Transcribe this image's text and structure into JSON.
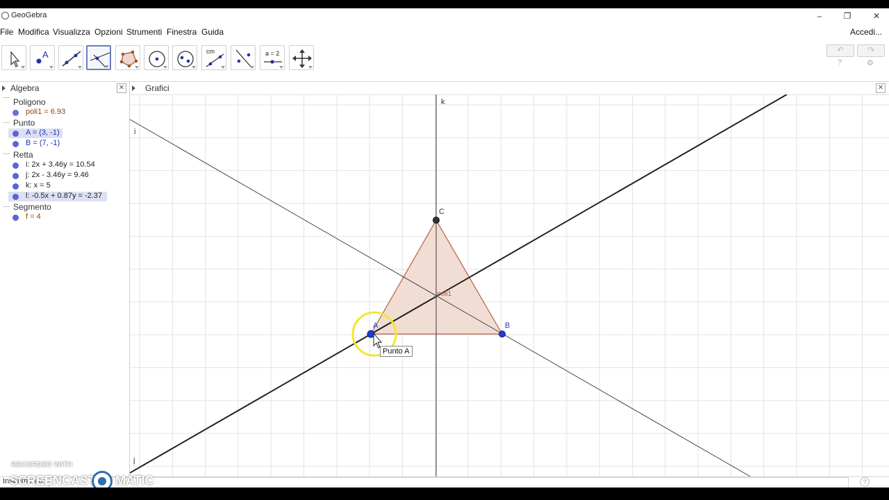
{
  "window": {
    "title": "GeoGebra",
    "controls": [
      "–",
      "❐",
      "✕"
    ]
  },
  "menu": {
    "items": [
      "File",
      "Modifica",
      "Visualizza",
      "Opzioni",
      "Strumenti",
      "Finestra",
      "Guida"
    ],
    "signin": "Accedi..."
  },
  "toolbar": {
    "tools": [
      {
        "name": "move-tool-icon"
      },
      {
        "name": "point-tool-icon",
        "label": "A"
      },
      {
        "name": "line-tool-icon"
      },
      {
        "name": "perpendicular-line-tool-icon",
        "selected": true
      },
      {
        "name": "polygon-tool-icon"
      },
      {
        "name": "circle-tool-icon"
      },
      {
        "name": "ellipse-tool-icon"
      },
      {
        "name": "angle-tool-icon",
        "label": "cm"
      },
      {
        "name": "reflect-tool-icon"
      },
      {
        "name": "slider-tool-icon",
        "label": "a = 2"
      },
      {
        "name": "move-graphics-tool-icon"
      }
    ],
    "undo": "↶",
    "redo": "↷",
    "help_icon": "?",
    "settings_icon": "⚙"
  },
  "algebra": {
    "title": "Algebra",
    "close": "✕",
    "categories": [
      {
        "name": "Poligono",
        "items": [
          {
            "text": "poli1 = 6.93",
            "color": "#8b4513",
            "highlight": false
          }
        ]
      },
      {
        "name": "Punto",
        "items": [
          {
            "text": "A = (3, -1)",
            "color": "#2233aa",
            "highlight": true
          },
          {
            "text": "B = (7, -1)",
            "color": "#2233aa",
            "highlight": false
          }
        ]
      },
      {
        "name": "Retta",
        "items": [
          {
            "text": "i: 2x + 3.46y = 10.54",
            "color": "#111111",
            "highlight": false
          },
          {
            "text": "j: 2x - 3.46y = 9.46",
            "color": "#111111",
            "highlight": false
          },
          {
            "text": "k: x = 5",
            "color": "#111111",
            "highlight": false
          },
          {
            "text": "l: -0.5x + 0.87y = -2.37",
            "color": "#111111",
            "highlight": true
          }
        ]
      },
      {
        "name": "Segmento",
        "items": [
          {
            "text": "f = 4",
            "color": "#8b4513",
            "highlight": false
          }
        ]
      }
    ]
  },
  "graphics": {
    "title": "Grafici",
    "close": "✕",
    "labels": {
      "line_i": "i",
      "line_j": "j",
      "line_k": "k",
      "point_A": "A",
      "point_B": "B",
      "point_C": "C",
      "polygon": "poli1"
    },
    "tooltip": "Punto A",
    "colors": {
      "polygon_fill": "#f2ddd5",
      "polygon_stroke": "#b06040",
      "point": "#1f3fd0",
      "point_C": "#333333",
      "highlight_ring": "#f5e62a"
    }
  },
  "input": {
    "label": "Inserimento:",
    "help": "?"
  },
  "watermark": {
    "line1": "RECORDED WITH",
    "line2a": "SCREENCAST",
    "line2b": "MATIC"
  }
}
